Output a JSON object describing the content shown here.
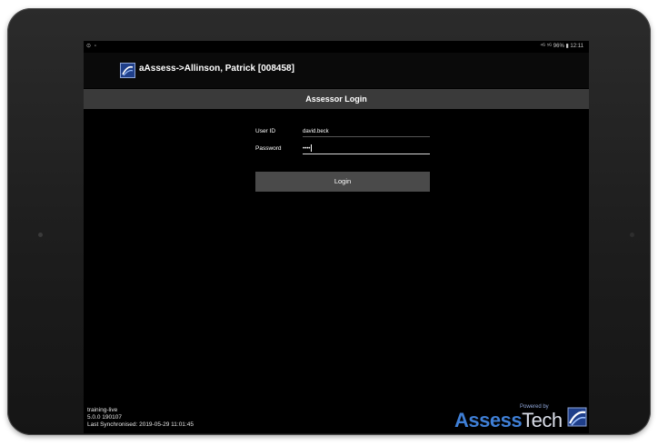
{
  "status_bar": {
    "left_icons": "⊙ ▫",
    "right_text": "⁴ᴳ ⁵ᴳ 96% ▮ 12:11"
  },
  "app_bar": {
    "title": "aAssess->Allinson, Patrick [008458]"
  },
  "header": {
    "title": "Assessor Login"
  },
  "form": {
    "user_id_label": "User ID",
    "user_id_value": "david.beck",
    "password_label": "Password",
    "password_value": "••••",
    "login_label": "Login"
  },
  "footer": {
    "environment": "training-live",
    "version": "5.0.0 190107",
    "last_sync": "Last Synchronised: 2019-05-29 11:01:45",
    "powered_by": "Powered by",
    "brand_part1": "Assess",
    "brand_part2": "Tech"
  },
  "colors": {
    "screen_background": "#000000",
    "header_background": "#3a3a3a",
    "button_background": "#4a4a4a",
    "brand_blue": "#3f7fd6"
  },
  "icons": [
    "app-logo-icon",
    "assesstech-logo-icon"
  ]
}
